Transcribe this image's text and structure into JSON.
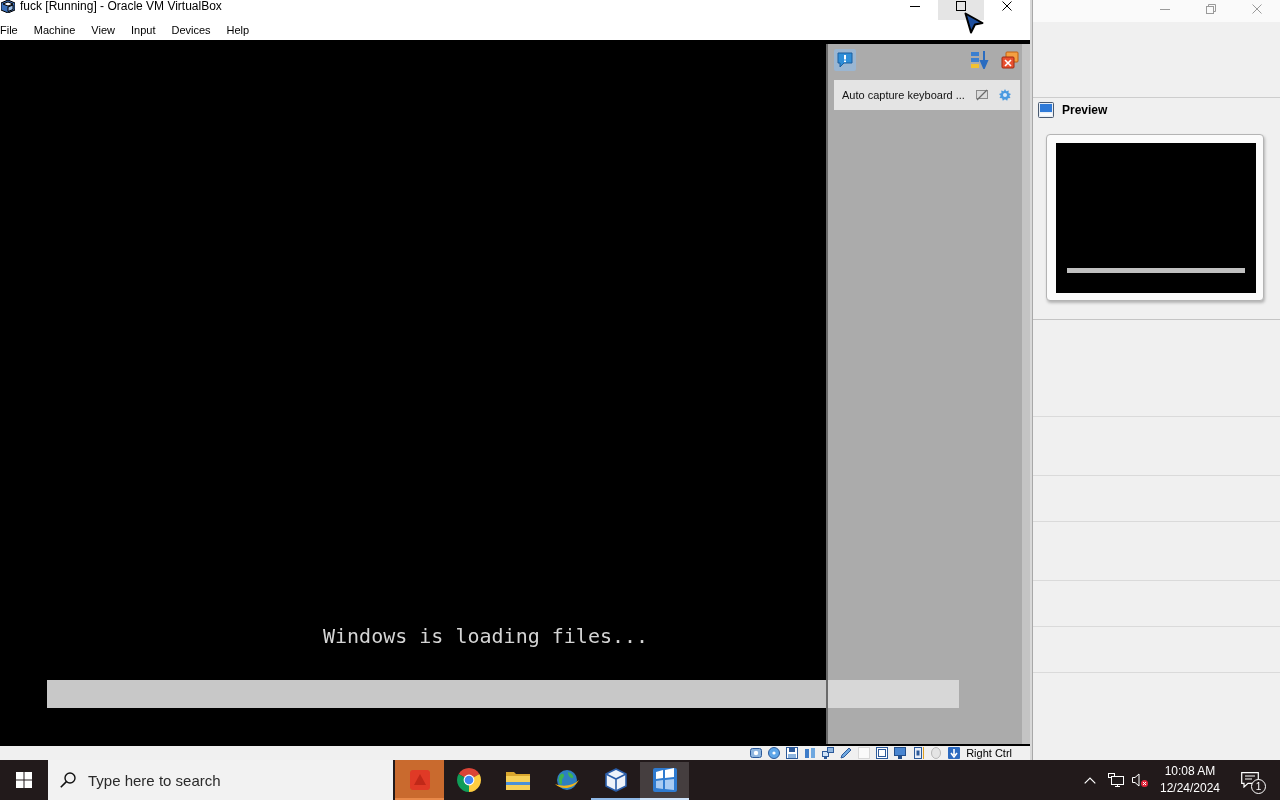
{
  "vm_window": {
    "title": "fuck [Running] - Oracle VM VirtualBox",
    "active": true,
    "controls": [
      {
        "kind": "minimize",
        "hovered": false
      },
      {
        "kind": "maximize",
        "hovered": true
      },
      {
        "kind": "close",
        "hovered": false
      }
    ],
    "menu": [
      "File",
      "Machine",
      "View",
      "Input",
      "Devices",
      "Help"
    ],
    "guest_screen": {
      "message": "Windows is loading files...",
      "progress": {
        "level": 1
      }
    },
    "notification_center": {
      "notifications": [
        {
          "text": "Auto capture keyboard ..."
        }
      ]
    },
    "status_bar": {
      "host_key": "Right Ctrl"
    }
  },
  "manager_window": {
    "active": false,
    "controls": [
      {
        "kind": "minimize",
        "hovered": false
      },
      {
        "kind": "restore",
        "hovered": false
      },
      {
        "kind": "close",
        "hovered": false
      }
    ],
    "preview": {
      "title": "Preview"
    }
  },
  "taskbar": {
    "search": {
      "placeholder": "Type here to search"
    },
    "apps": [
      {
        "kind": "flag",
        "running": true,
        "flashing": true,
        "selected": false
      },
      {
        "kind": "browser",
        "running": false,
        "flashing": false,
        "selected": false
      },
      {
        "kind": "folder",
        "running": false,
        "flashing": false,
        "selected": false
      },
      {
        "kind": "globe",
        "running": false,
        "flashing": false,
        "selected": false
      },
      {
        "kind": "cube",
        "running": true,
        "flashing": false,
        "selected": false
      },
      {
        "kind": "vm",
        "running": true,
        "flashing": false,
        "selected": true
      }
    ],
    "clock": {
      "time": "10:08 AM",
      "date": "12/24/2024"
    },
    "notifications": {
      "count": "1"
    }
  }
}
